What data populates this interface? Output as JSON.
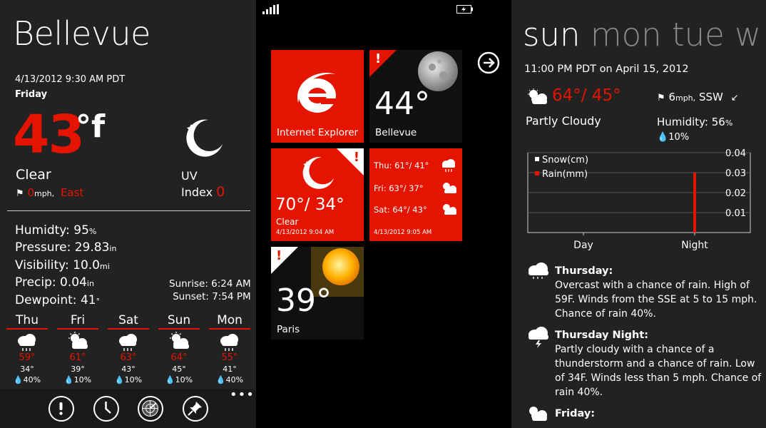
{
  "panel_current": {
    "city": "Bellevue",
    "datetime": "4/13/2012 9:30 AM PDT",
    "day": "Friday",
    "temp": "43",
    "unit": "°f",
    "condition": "Clear",
    "wind_speed": "0",
    "wind_unit": "mph,",
    "wind_dir": "East",
    "uv_label": "UV",
    "uv_index_label": "Index",
    "uv_value": "0",
    "stats": [
      {
        "label": "Humidty: ",
        "value": "95",
        "unit": "%"
      },
      {
        "label": "Pressure: ",
        "value": "29.83",
        "unit": "in"
      },
      {
        "label": "Visibility: ",
        "value": "10.0",
        "unit": "mi"
      },
      {
        "label": "Precip: ",
        "value": "0.04",
        "unit": "in"
      },
      {
        "label": "Dewpoint: ",
        "value": "41",
        "unit": "°"
      }
    ],
    "sunrise": "Sunrise: 6:24 AM",
    "sunset": "Sunset: 7:54 PM",
    "forecast": [
      {
        "day": "Thu",
        "icon": "rain-cloud-icon",
        "hi": "59°",
        "lo": "34°",
        "precip": "40%"
      },
      {
        "day": "Fri",
        "icon": "partly-cloudy-icon",
        "hi": "61°",
        "lo": "39°",
        "precip": "10%"
      },
      {
        "day": "Sat",
        "icon": "rain-cloud-icon",
        "hi": "63°",
        "lo": "43°",
        "precip": "10%"
      },
      {
        "day": "Sun",
        "icon": "partly-cloudy-icon",
        "hi": "64°",
        "lo": "45°",
        "precip": "10%"
      },
      {
        "day": "Mon",
        "icon": "rain-cloud-icon",
        "hi": "55°",
        "lo": "41°",
        "precip": "40%"
      }
    ],
    "appbar_more": "•••"
  },
  "panel_tiles": {
    "tiles": {
      "ie": {
        "label": "Internet Explorer"
      },
      "bellevue": {
        "temp": "44°",
        "city": "Bellevue"
      },
      "clear": {
        "temp": "70°/ 34°",
        "condition": "Clear",
        "date": "4/13/2012 9:04 AM"
      },
      "forecast": {
        "rows": [
          {
            "day": "Thu:",
            "temps": "61°/ 41°"
          },
          {
            "day": "Fri:",
            "temps": "63°/ 37°"
          },
          {
            "day": "Sat:",
            "temps": "64°/ 43°"
          }
        ],
        "date": "4/13/2012 9:05 AM"
      },
      "paris": {
        "temp": "39°",
        "city": "Paris"
      }
    },
    "warn": "!"
  },
  "panel_detail": {
    "day_active": "sun",
    "days_inactive": "mon tue w",
    "datetime": "11:00 PM PDT on April 15, 2012",
    "temp": "64°/ 45°",
    "condition": "Partly Cloudy",
    "wind_speed": "6",
    "wind_unit": "mph,",
    "wind_dir": "SSW",
    "humidity_label": "Humidity: ",
    "humidity_value": "56",
    "humidity_unit": "%",
    "precip": "10%",
    "forecasts": [
      {
        "title": "Thursday:",
        "text": "Overcast with a chance of rain. High of 59F. Winds from the SSE at 5 to 15 mph. Chance of rain 40%."
      },
      {
        "title": "Thursday Night:",
        "text": "Partly cloudy with a chance of a thunderstorm and a chance of rain. Low of 34F. Winds less than 5 mph. Chance of rain 40%."
      },
      {
        "title": "Friday:",
        "text": ""
      }
    ]
  },
  "chart_data": {
    "type": "bar",
    "categories": [
      "Day",
      "Night"
    ],
    "series": [
      {
        "name": "Snow(cm)",
        "values": [
          0,
          0
        ]
      },
      {
        "name": "Rain(mm)",
        "values": [
          0,
          0.03
        ]
      }
    ],
    "yticks": [
      "0.04",
      "0.03",
      "0.02",
      "0.01"
    ],
    "ylim": [
      0,
      0.04
    ],
    "grid": true,
    "legend": "top-left",
    "colors": {
      "snow": "#ffffff",
      "rain": "#e51400"
    }
  },
  "colors": {
    "accent": "#e51400",
    "panel": "#222222",
    "inactive": "#8a8a8a"
  }
}
